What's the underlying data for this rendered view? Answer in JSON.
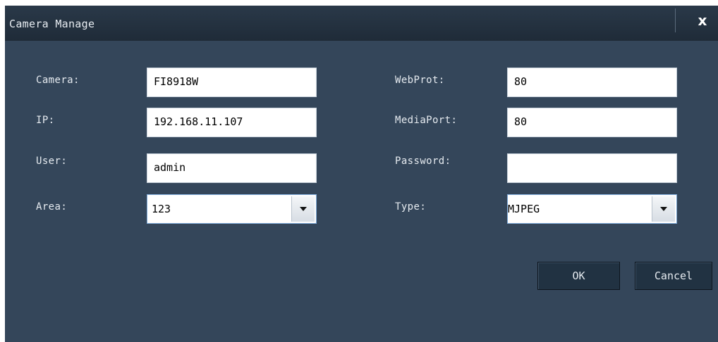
{
  "dialog": {
    "title": "Camera Manage",
    "close_glyph": "x"
  },
  "fields": {
    "camera": {
      "label": "Camera:",
      "value": "FI8918W"
    },
    "ip": {
      "label": "IP:",
      "value": "192.168.11.107"
    },
    "user": {
      "label": "User:",
      "value": "admin"
    },
    "area": {
      "label": "Area:",
      "value": "123"
    },
    "webport": {
      "label": "WebProt:",
      "value": "80"
    },
    "mediaport": {
      "label": "MediaPort:",
      "value": "80"
    },
    "password": {
      "label": "Password:",
      "value": ""
    },
    "type": {
      "label": "Type:",
      "value": "MJPEG"
    }
  },
  "buttons": {
    "ok": "OK",
    "cancel": "Cancel"
  },
  "icons": {
    "close": "close-icon",
    "dropdown": "chevron-down-icon"
  },
  "colors": {
    "panel_bg": "#34465a",
    "titlebar_bg": "#1f2b38",
    "button_bg": "#213242",
    "select_border": "#7aa7d6"
  }
}
